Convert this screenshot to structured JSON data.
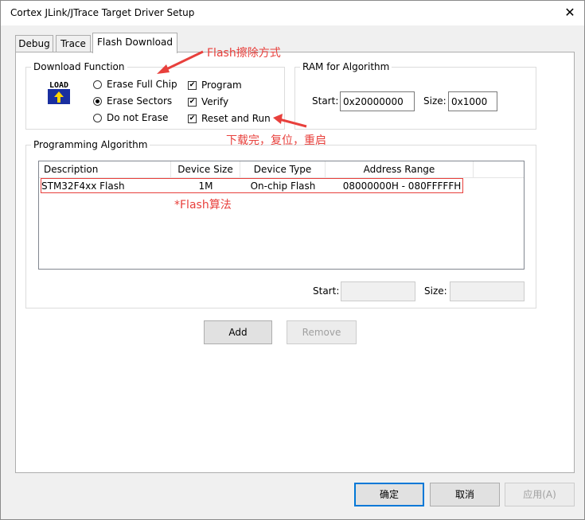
{
  "window": {
    "title": "Cortex JLink/JTrace Target Driver Setup",
    "close_glyph": "✕"
  },
  "tabs": [
    {
      "label": "Debug",
      "active": false
    },
    {
      "label": "Trace",
      "active": false
    },
    {
      "label": "Flash Download",
      "active": true
    }
  ],
  "download_function": {
    "legend": "Download Function",
    "load_icon_text": "LOAD",
    "radios": [
      {
        "label": "Erase Full Chip",
        "checked": false
      },
      {
        "label": "Erase Sectors",
        "checked": true
      },
      {
        "label": "Do not Erase",
        "checked": false
      }
    ],
    "checks": [
      {
        "label": "Program",
        "checked": true
      },
      {
        "label": "Verify",
        "checked": true
      },
      {
        "label": "Reset and Run",
        "checked": true
      }
    ]
  },
  "ram_for_algorithm": {
    "legend": "RAM for Algorithm",
    "start_label": "Start:",
    "start_value": "0x20000000",
    "size_label": "Size:",
    "size_value": "0x1000"
  },
  "programming_algorithm": {
    "legend": "Programming Algorithm",
    "columns": [
      "Description",
      "Device Size",
      "Device Type",
      "Address Range"
    ],
    "rows": [
      {
        "description": "STM32F4xx Flash",
        "device_size": "1M",
        "device_type": "On-chip Flash",
        "address_range": "08000000H - 080FFFFFH"
      }
    ],
    "start_label": "Start:",
    "start_value": "",
    "size_label": "Size:",
    "size_value": ""
  },
  "buttons": {
    "add": "Add",
    "remove": "Remove",
    "ok": "确定",
    "cancel": "取消",
    "apply": "应用(A)"
  },
  "annotations": {
    "erase_mode": "Flash擦除方式",
    "reset_run": "下载完，复位，重启",
    "algorithm": "*Flash算法"
  },
  "colors": {
    "annotation_red": "#e8403c",
    "window_bg": "#f0f0f0",
    "focus_blue": "#0078d7"
  }
}
